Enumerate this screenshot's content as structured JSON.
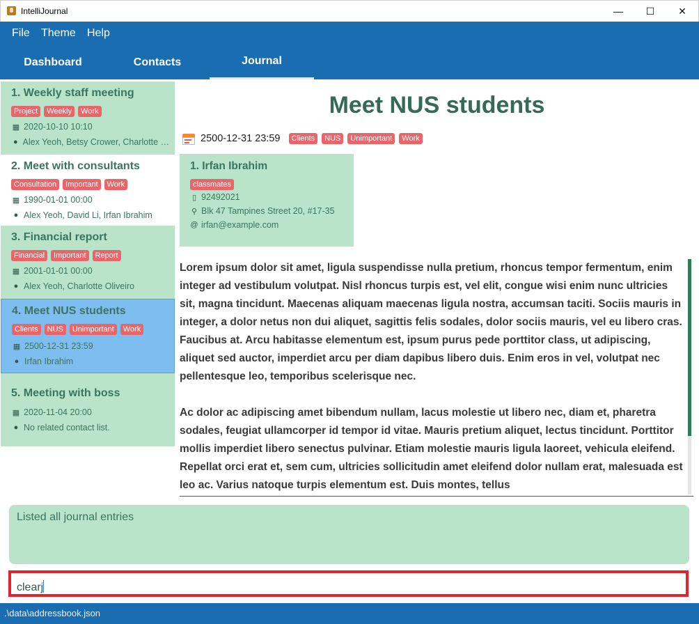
{
  "window": {
    "title": "IntelliJournal",
    "minimize_label": "—",
    "maximize_label": "☐",
    "close_label": "✕"
  },
  "menu": {
    "file": "File",
    "theme": "Theme",
    "help": "Help"
  },
  "tabs": {
    "dashboard": "Dashboard",
    "contacts": "Contacts",
    "journal": "Journal",
    "active": "Journal"
  },
  "entries": [
    {
      "title": "1.  Weekly staff meeting",
      "tags": [
        "Project",
        "Weekly",
        "Work"
      ],
      "date": "2020-10-10 10:10",
      "contacts": "Alex Yeoh, Betsy Crower, Charlotte Oliveiro"
    },
    {
      "title": "2.  Meet with consultants",
      "tags": [
        "Consultation",
        "Important",
        "Work"
      ],
      "date": "1990-01-01 00:00",
      "contacts": "Alex Yeoh, David Li, Irfan Ibrahim"
    },
    {
      "title": "3.  Financial report",
      "tags": [
        "Financial",
        "Important",
        "Report"
      ],
      "date": "2001-01-01 00:00",
      "contacts": "Alex Yeoh, Charlotte Oliveiro"
    },
    {
      "title": "4.  Meet NUS students",
      "tags": [
        "Clients",
        "NUS",
        "Unimportant",
        "Work"
      ],
      "date": "2500-12-31 23:59",
      "contacts": "Irfan Ibrahim"
    },
    {
      "title": "5.  Meeting with boss",
      "tags": [],
      "date": "2020-11-04 20:00",
      "contacts": "No related contact list."
    }
  ],
  "detail": {
    "title": "Meet NUS students",
    "date": "2500-12-31 23:59",
    "tags": [
      "Clients",
      "NUS",
      "Unimportant",
      "Work"
    ],
    "contact": {
      "name": "1.  Irfan Ibrahim",
      "tag": "classmates",
      "phone": "92492021",
      "address": "Blk 47 Tampines Street 20, #17-35",
      "email": "irfan@example.com"
    },
    "description": [
      "Lorem ipsum dolor sit amet, ligula suspendisse nulla pretium, rhoncus tempor fermentum, enim integer ad vestibulum volutpat. Nisl rhoncus turpis est, vel elit, congue wisi enim nunc ultricies sit, magna tincidunt. Maecenas aliquam maecenas ligula nostra, accumsan taciti. Sociis mauris in integer, a dolor netus non dui aliquet, sagittis felis sodales, dolor sociis mauris, vel eu libero cras. Faucibus at. Arcu habitasse elementum est, ipsum purus pede porttitor class, ut adipiscing, aliquet sed auctor, imperdiet arcu per diam dapibus libero duis. Enim eros in vel, volutpat nec pellentesque leo, temporibus scelerisque nec.",
      "Ac dolor ac adipiscing amet bibendum nullam, lacus molestie ut libero nec, diam et, pharetra sodales, feugiat ullamcorper id tempor id vitae. Mauris pretium aliquet, lectus tincidunt. Porttitor mollis imperdiet libero senectus pulvinar. Etiam molestie mauris ligula laoreet, vehicula eleifend. Repellat orci erat et, sem cum, ultricies sollicitudin amet eleifend dolor nullam erat, malesuada est leo ac. Varius natoque turpis elementum est. Duis montes, tellus"
    ]
  },
  "result": {
    "text": "Listed all journal entries"
  },
  "command": {
    "value": "clearj"
  },
  "status": {
    "path": ".\\data\\addressbook.json"
  },
  "colors": {
    "primary": "#1b6db1",
    "card_green": "#b9e4c9",
    "selected_blue": "#7ebdf0",
    "tag_red": "#e8666a",
    "command_border": "#e0242c"
  },
  "icons": {
    "date": "calendar-icon",
    "contacts": "person-icon",
    "phone": "phone-icon",
    "address": "location-pin-icon",
    "email": "at-icon"
  }
}
